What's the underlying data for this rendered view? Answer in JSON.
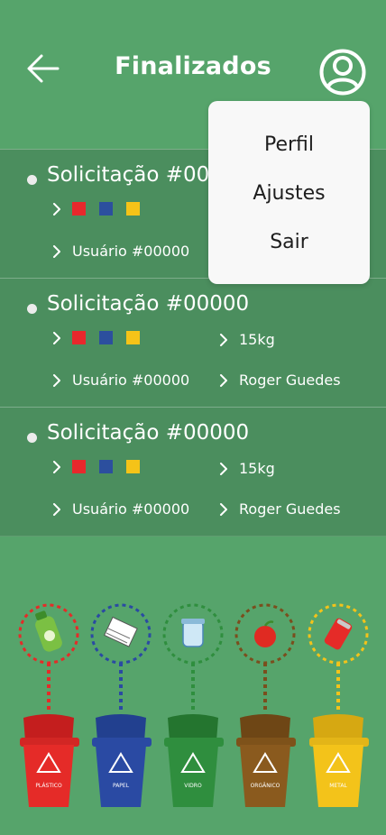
{
  "header": {
    "title": "Finalizados"
  },
  "menu": {
    "items": [
      "Perfil",
      "Ajustes",
      "Sair"
    ]
  },
  "requests": [
    {
      "title": "Solicitação #00000",
      "user": "Usuário #00000",
      "weight": "",
      "collector": ""
    },
    {
      "title": "Solicitação #00000",
      "user": "Usuário #00000",
      "weight": "15kg",
      "collector": "Roger Guedes"
    },
    {
      "title": "Solicitação #00000",
      "user": "Usuário #00000",
      "weight": "15kg",
      "collector": "Roger Guedes"
    }
  ],
  "material_colors": [
    "#e8282c",
    "#2c4f9e",
    "#f5c318"
  ],
  "bins": [
    {
      "label": "PLÁSTICO",
      "color": "#e52b28",
      "icon": "bottle-icon"
    },
    {
      "label": "PAPEL",
      "color": "#2a4aa3",
      "icon": "paper-icon"
    },
    {
      "label": "VIDRO",
      "color": "#2f8e3e",
      "icon": "jar-icon"
    },
    {
      "label": "ORGÂNICO",
      "color": "#8a5a1e",
      "icon": "apple-icon"
    },
    {
      "label": "METAL",
      "color": "#f3c31a",
      "icon": "can-icon"
    }
  ]
}
